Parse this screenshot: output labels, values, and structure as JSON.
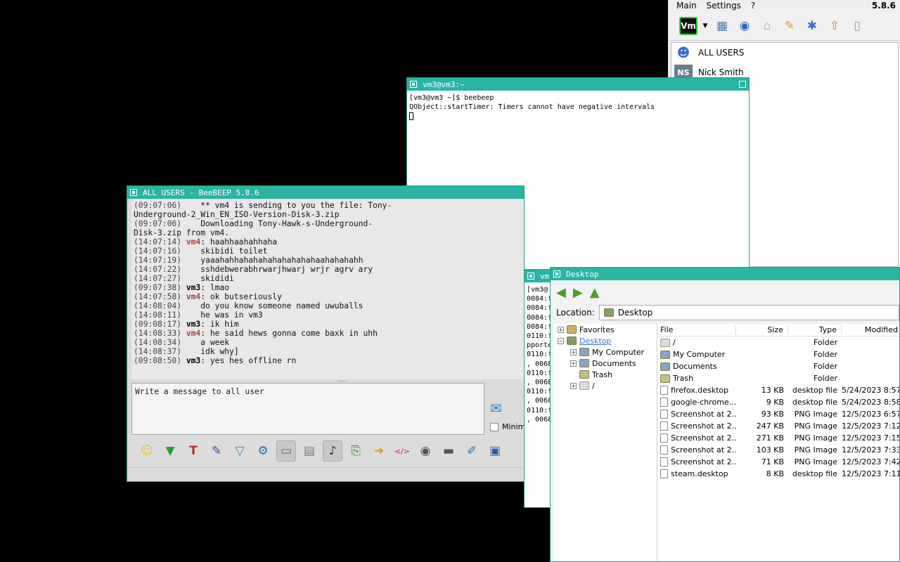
{
  "beebeep_main": {
    "menu": [
      "Main",
      "Settings",
      "?"
    ],
    "version": "5.8.6",
    "toolbar_icons": [
      "vm-status-icon",
      "dropdown-arrow-icon",
      "edit-profile-icon",
      "network-icon",
      "home-icon",
      "pen-icon",
      "tools-icon",
      "update-icon",
      "trash-icon"
    ],
    "users": [
      {
        "label": "ALL USERS",
        "avatar": ""
      },
      {
        "label": "Nick Smith",
        "avatar": "NS"
      }
    ]
  },
  "terminal": {
    "title": "vm3@vm3:~",
    "lines": [
      "[vm3@vm3 ~]$ beebeep",
      "QObject::startTimer: Timers cannot have negative intervals"
    ]
  },
  "chat": {
    "title": "ALL USERS - BeeBEEP 5.8.6",
    "messages": [
      {
        "ts": "(09:07:06)",
        "who": "",
        "text": "** vm4 is sending to you the file: Tony-"
      },
      {
        "ts": "",
        "who": "",
        "text": "Underground-2_Win_EN_ISO-Version-Disk-3.zip"
      },
      {
        "ts": "(09:07:06)",
        "who": "",
        "text": "Downloading Tony-Hawk-s-Underground-"
      },
      {
        "ts": "",
        "who": "",
        "text": "Disk-3.zip from vm4."
      },
      {
        "ts": "(14:07:14)",
        "who": "vm4",
        "text": "haahhaahahhaha"
      },
      {
        "ts": "(14:07:16)",
        "who": "",
        "text": "skibidi toilet"
      },
      {
        "ts": "(14:07:19)",
        "who": "",
        "text": "yaaahahhahahahahahahahahaahahahahh"
      },
      {
        "ts": "(14:07:22)",
        "who": "",
        "text": "sshdebwerabhrwarjhwarj wrjr agrv ary"
      },
      {
        "ts": "(14:07:27)",
        "who": "",
        "text": "skididi"
      },
      {
        "ts": "(09:07:38)",
        "who": "vm3",
        "text": "lmao"
      },
      {
        "ts": "(14:07:58)",
        "who": "vm4",
        "text": "ok butseriously"
      },
      {
        "ts": "(14:08:04)",
        "who": "",
        "text": "do you know someone named uwuballs"
      },
      {
        "ts": "(14:08:11)",
        "who": "",
        "text": "he was in vm3"
      },
      {
        "ts": "(09:08:17)",
        "who": "vm3",
        "text": "ik him"
      },
      {
        "ts": "(14:08:33)",
        "who": "vm4",
        "text": "he said hews gonna come baxk in uhh"
      },
      {
        "ts": "(14:08:34)",
        "who": "",
        "text": "a week"
      },
      {
        "ts": "(14:08:37)",
        "who": "",
        "text": "idk why]"
      },
      {
        "ts": "(09:08:50)",
        "who": "vm3",
        "text": "yes hes offline rn"
      }
    ],
    "compose_placeholder": "Write a message to all user",
    "minimize_label": "Minim"
  },
  "terminal2": {
    "title": "vm",
    "lines": [
      "[vm3@",
      "0084:f",
      "0084:f",
      "0084:f",
      "0084:f",
      "0110:f",
      "pporte",
      "0110:f",
      ", 0068",
      "0110:f",
      ", 0068",
      "0110:f",
      ", 0068",
      "0110:f",
      ", 0068"
    ]
  },
  "file_manager": {
    "title": "Desktop",
    "location_label": "Location:",
    "location_value": "Desktop",
    "tree": [
      {
        "label": "Favorites",
        "indent": 0,
        "exp": "+",
        "icon": "folder"
      },
      {
        "label": "Desktop",
        "indent": 0,
        "exp": "−",
        "icon": "desk",
        "selected": true
      },
      {
        "label": "My Computer",
        "indent": 1,
        "exp": "+",
        "icon": "comp"
      },
      {
        "label": "Documents",
        "indent": 1,
        "exp": "+",
        "icon": "comp"
      },
      {
        "label": "Trash",
        "indent": 1,
        "exp": "",
        "icon": "trash"
      },
      {
        "label": "/",
        "indent": 1,
        "exp": "+",
        "icon": "drive"
      }
    ],
    "columns": [
      "File",
      "Size",
      "Type",
      "Modified"
    ],
    "files": [
      {
        "name": "/",
        "size": "",
        "type": "Folder",
        "modified": "",
        "icon": "drive"
      },
      {
        "name": "My Computer",
        "size": "",
        "type": "Folder",
        "modified": "",
        "icon": "comp"
      },
      {
        "name": "Documents",
        "size": "",
        "type": "Folder",
        "modified": "",
        "icon": "comp"
      },
      {
        "name": "Trash",
        "size": "",
        "type": "Folder",
        "modified": "",
        "icon": "trash"
      },
      {
        "name": "firefox.desktop",
        "size": "13 KB",
        "type": "desktop file",
        "modified": "5/24/2023 8:57...",
        "icon": "file"
      },
      {
        "name": "google-chrome....",
        "size": "9 KB",
        "type": "desktop file",
        "modified": "5/24/2023 8:58...",
        "icon": "file"
      },
      {
        "name": "Screenshot at 2...",
        "size": "93 KB",
        "type": "PNG Image",
        "modified": "12/5/2023 6:57...",
        "icon": "file"
      },
      {
        "name": "Screenshot at 2...",
        "size": "247 KB",
        "type": "PNG Image",
        "modified": "12/5/2023 7:12...",
        "icon": "file"
      },
      {
        "name": "Screenshot at 2...",
        "size": "271 KB",
        "type": "PNG Image",
        "modified": "12/5/2023 7:15...",
        "icon": "file"
      },
      {
        "name": "Screenshot at 2...",
        "size": "103 KB",
        "type": "PNG Image",
        "modified": "12/5/2023 7:33...",
        "icon": "file"
      },
      {
        "name": "Screenshot at 2...",
        "size": "71 KB",
        "type": "PNG Image",
        "modified": "12/5/2023 7:42...",
        "icon": "file"
      },
      {
        "name": "steam.desktop",
        "size": "8 KB",
        "type": "desktop file",
        "modified": "12/5/2023 7:11...",
        "icon": "file"
      }
    ]
  }
}
